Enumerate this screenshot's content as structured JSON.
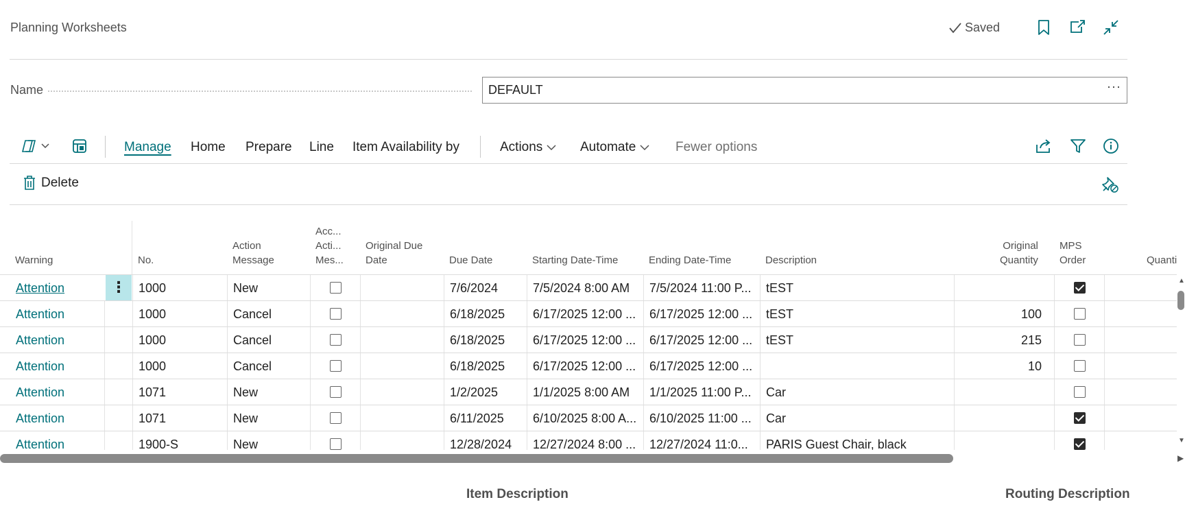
{
  "header": {
    "title": "Planning Worksheets",
    "status": "Saved"
  },
  "name_field": {
    "label": "Name",
    "value": "DEFAULT"
  },
  "actionbar": {
    "tabs": [
      "Manage",
      "Home",
      "Prepare",
      "Line",
      "Item Availability by"
    ],
    "actions_label": "Actions",
    "automate_label": "Automate",
    "fewer_options_label": "Fewer options",
    "delete_label": "Delete"
  },
  "grid": {
    "columns": {
      "warning": "Warning",
      "no": "No.",
      "action_message": [
        "Action",
        "Message"
      ],
      "accept_action_message": [
        "Acc...",
        "Acti...",
        "Mes..."
      ],
      "original_due_date": [
        "Original Due",
        "Date"
      ],
      "due_date": "Due Date",
      "starting_date_time": "Starting Date-Time",
      "ending_date_time": "Ending Date-Time",
      "description": "Description",
      "original_quantity": [
        "Original",
        "Quantity"
      ],
      "mps_order": [
        "MPS",
        "Order"
      ],
      "quantity": "Quantity"
    },
    "rows": [
      {
        "warning": "Attention",
        "no": "1000",
        "action": "New",
        "accept": false,
        "orig_due": "",
        "due": "7/6/2024",
        "start": "7/5/2024 8:00 AM",
        "end": "7/5/2024 11:00 P...",
        "desc": "tEST",
        "orig_qty": "",
        "mps": true
      },
      {
        "warning": "Attention",
        "no": "1000",
        "action": "Cancel",
        "accept": false,
        "orig_due": "",
        "due": "6/18/2025",
        "start": "6/17/2025 12:00 ...",
        "end": "6/17/2025 12:00 ...",
        "desc": "tEST",
        "orig_qty": "100",
        "mps": false
      },
      {
        "warning": "Attention",
        "no": "1000",
        "action": "Cancel",
        "accept": false,
        "orig_due": "",
        "due": "6/18/2025",
        "start": "6/17/2025 12:00 ...",
        "end": "6/17/2025 12:00 ...",
        "desc": "tEST",
        "orig_qty": "215",
        "mps": false
      },
      {
        "warning": "Attention",
        "no": "1000",
        "action": "Cancel",
        "accept": false,
        "orig_due": "",
        "due": "6/18/2025",
        "start": "6/17/2025 12:00 ...",
        "end": "6/17/2025 12:00 ...",
        "desc": "",
        "orig_qty": "10",
        "mps": false
      },
      {
        "warning": "Attention",
        "no": "1071",
        "action": "New",
        "accept": false,
        "orig_due": "",
        "due": "1/2/2025",
        "start": "1/1/2025 8:00 AM",
        "end": "1/1/2025 11:00 P...",
        "desc": "Car",
        "orig_qty": "",
        "mps": false
      },
      {
        "warning": "Attention",
        "no": "1071",
        "action": "New",
        "accept": false,
        "orig_due": "",
        "due": "6/11/2025",
        "start": "6/10/2025 8:00 A...",
        "end": "6/10/2025 11:00 ...",
        "desc": "Car",
        "orig_qty": "",
        "mps": true
      },
      {
        "warning": "Attention",
        "no": "1900-S",
        "action": "New",
        "accept": false,
        "orig_due": "",
        "due": "12/28/2024",
        "start": "12/27/2024 8:00 ...",
        "end": "12/27/2024 11:0...",
        "desc": "PARIS Guest Chair, black",
        "orig_qty": "",
        "mps": true
      }
    ]
  },
  "footer": {
    "item_description_label": "Item Description",
    "routing_description_label": "Routing Description"
  },
  "colors": {
    "accent": "#00707a",
    "selected_row_menu": "#b8e6ea",
    "text": "#212121",
    "muted": "#505050"
  },
  "icons": [
    "checkmark-icon",
    "bookmark-icon",
    "open-new-window-icon",
    "collapse-icon",
    "copilot-icon",
    "chevron-down-icon",
    "layout-icon",
    "share-icon",
    "filter-icon",
    "info-icon",
    "trash-icon",
    "unpin-icon",
    "more-icon"
  ]
}
